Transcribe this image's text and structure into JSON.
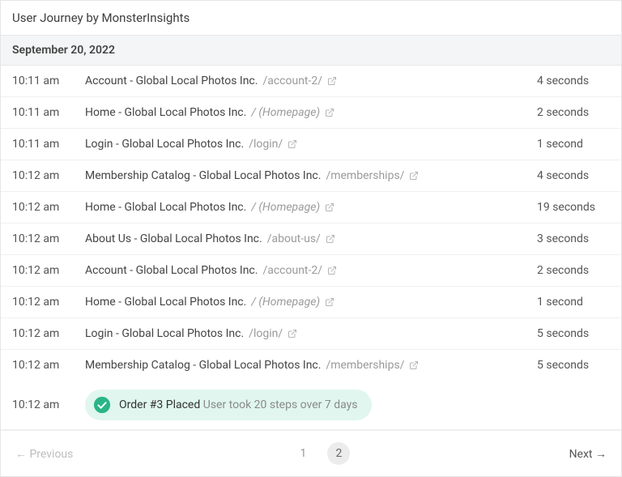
{
  "header": {
    "title": "User Journey by MonsterInsights",
    "date": "September 20, 2022"
  },
  "rows": [
    {
      "time": "10:11 am",
      "title": "Account - Global Local Photos Inc.",
      "path": "/account-2/",
      "duration": "4 seconds",
      "homepage": false
    },
    {
      "time": "10:11 am",
      "title": "Home - Global Local Photos Inc.",
      "path": "/ (Homepage)",
      "duration": "2 seconds",
      "homepage": true
    },
    {
      "time": "10:11 am",
      "title": "Login - Global Local Photos Inc.",
      "path": "/login/",
      "duration": "1 second",
      "homepage": false
    },
    {
      "time": "10:12 am",
      "title": "Membership Catalog - Global Local Photos Inc.",
      "path": "/memberships/",
      "duration": "4 seconds",
      "homepage": false
    },
    {
      "time": "10:12 am",
      "title": "Home - Global Local Photos Inc.",
      "path": "/ (Homepage)",
      "duration": "19 seconds",
      "homepage": true
    },
    {
      "time": "10:12 am",
      "title": "About Us - Global Local Photos Inc.",
      "path": "/about-us/",
      "duration": "3 seconds",
      "homepage": false
    },
    {
      "time": "10:12 am",
      "title": "Account - Global Local Photos Inc.",
      "path": "/account-2/",
      "duration": "2 seconds",
      "homepage": false
    },
    {
      "time": "10:12 am",
      "title": "Home - Global Local Photos Inc.",
      "path": "/ (Homepage)",
      "duration": "1 second",
      "homepage": true
    },
    {
      "time": "10:12 am",
      "title": "Login - Global Local Photos Inc.",
      "path": "/login/",
      "duration": "5 seconds",
      "homepage": false
    },
    {
      "time": "10:12 am",
      "title": "Membership Catalog - Global Local Photos Inc.",
      "path": "/memberships/",
      "duration": "5 seconds",
      "homepage": false
    }
  ],
  "order": {
    "time": "10:12 am",
    "title": "Order #3 Placed",
    "subtitle": "User took 20 steps over 7 days"
  },
  "pager": {
    "prev": "← Previous",
    "next": "Next →",
    "pages": [
      "1",
      "2"
    ],
    "current": 2
  }
}
